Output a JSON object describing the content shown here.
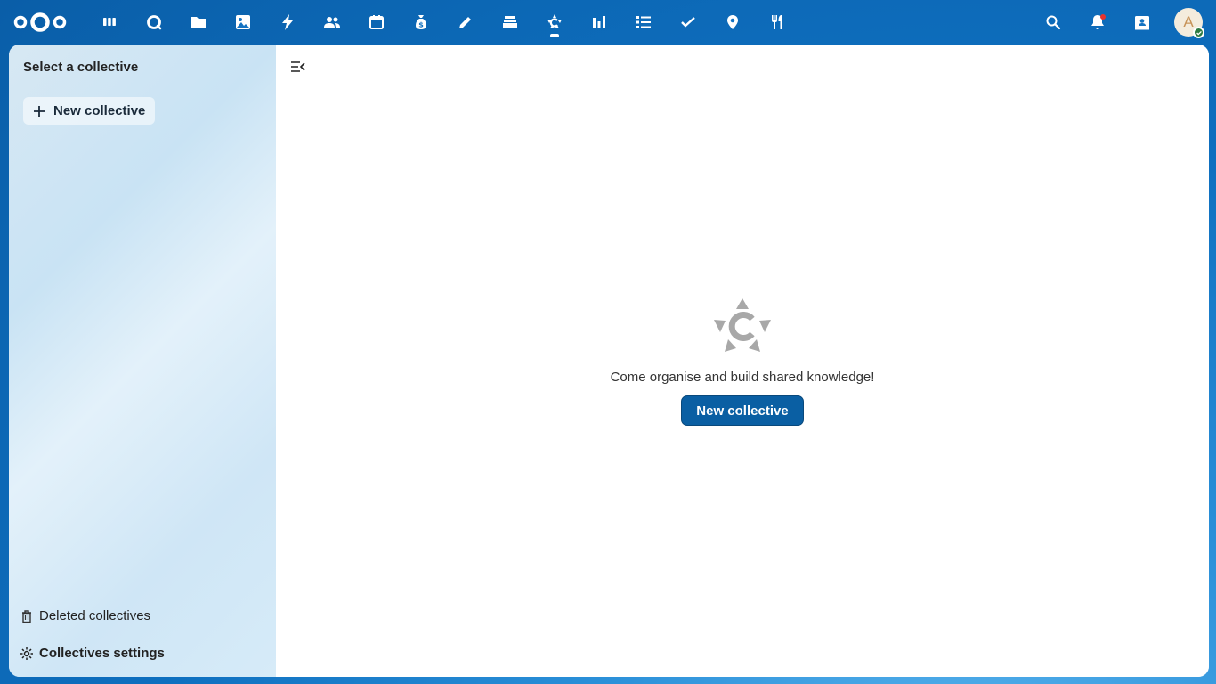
{
  "header": {
    "apps": [
      {
        "name": "dashboard",
        "icon": "dashboard-icon"
      },
      {
        "name": "talk",
        "icon": "talk-icon"
      },
      {
        "name": "files",
        "icon": "files-icon"
      },
      {
        "name": "photos",
        "icon": "photos-icon"
      },
      {
        "name": "activity",
        "icon": "activity-icon"
      },
      {
        "name": "contacts",
        "icon": "contacts-icon"
      },
      {
        "name": "calendar",
        "icon": "calendar-icon"
      },
      {
        "name": "cospend",
        "icon": "money-bag-icon"
      },
      {
        "name": "notes",
        "icon": "pencil-icon"
      },
      {
        "name": "deck",
        "icon": "deck-icon"
      },
      {
        "name": "collectives",
        "icon": "collectives-icon"
      },
      {
        "name": "analytics",
        "icon": "chart-icon"
      },
      {
        "name": "tasks",
        "icon": "list-icon"
      },
      {
        "name": "checks",
        "icon": "check-icon"
      },
      {
        "name": "maps",
        "icon": "location-pin-icon"
      },
      {
        "name": "cookbook",
        "icon": "fork-knife-icon"
      }
    ],
    "active_app": "collectives",
    "avatar_initial": "A"
  },
  "sidebar": {
    "title": "Select a collective",
    "new_button_label": "New collective",
    "deleted_label": "Deleted collectives",
    "settings_label": "Collectives settings"
  },
  "main": {
    "empty_message": "Come organise and build shared knowledge!",
    "new_button_label": "New collective"
  },
  "colors": {
    "primary": "#0a5fa3",
    "header_bg": "#0e6fbf"
  }
}
